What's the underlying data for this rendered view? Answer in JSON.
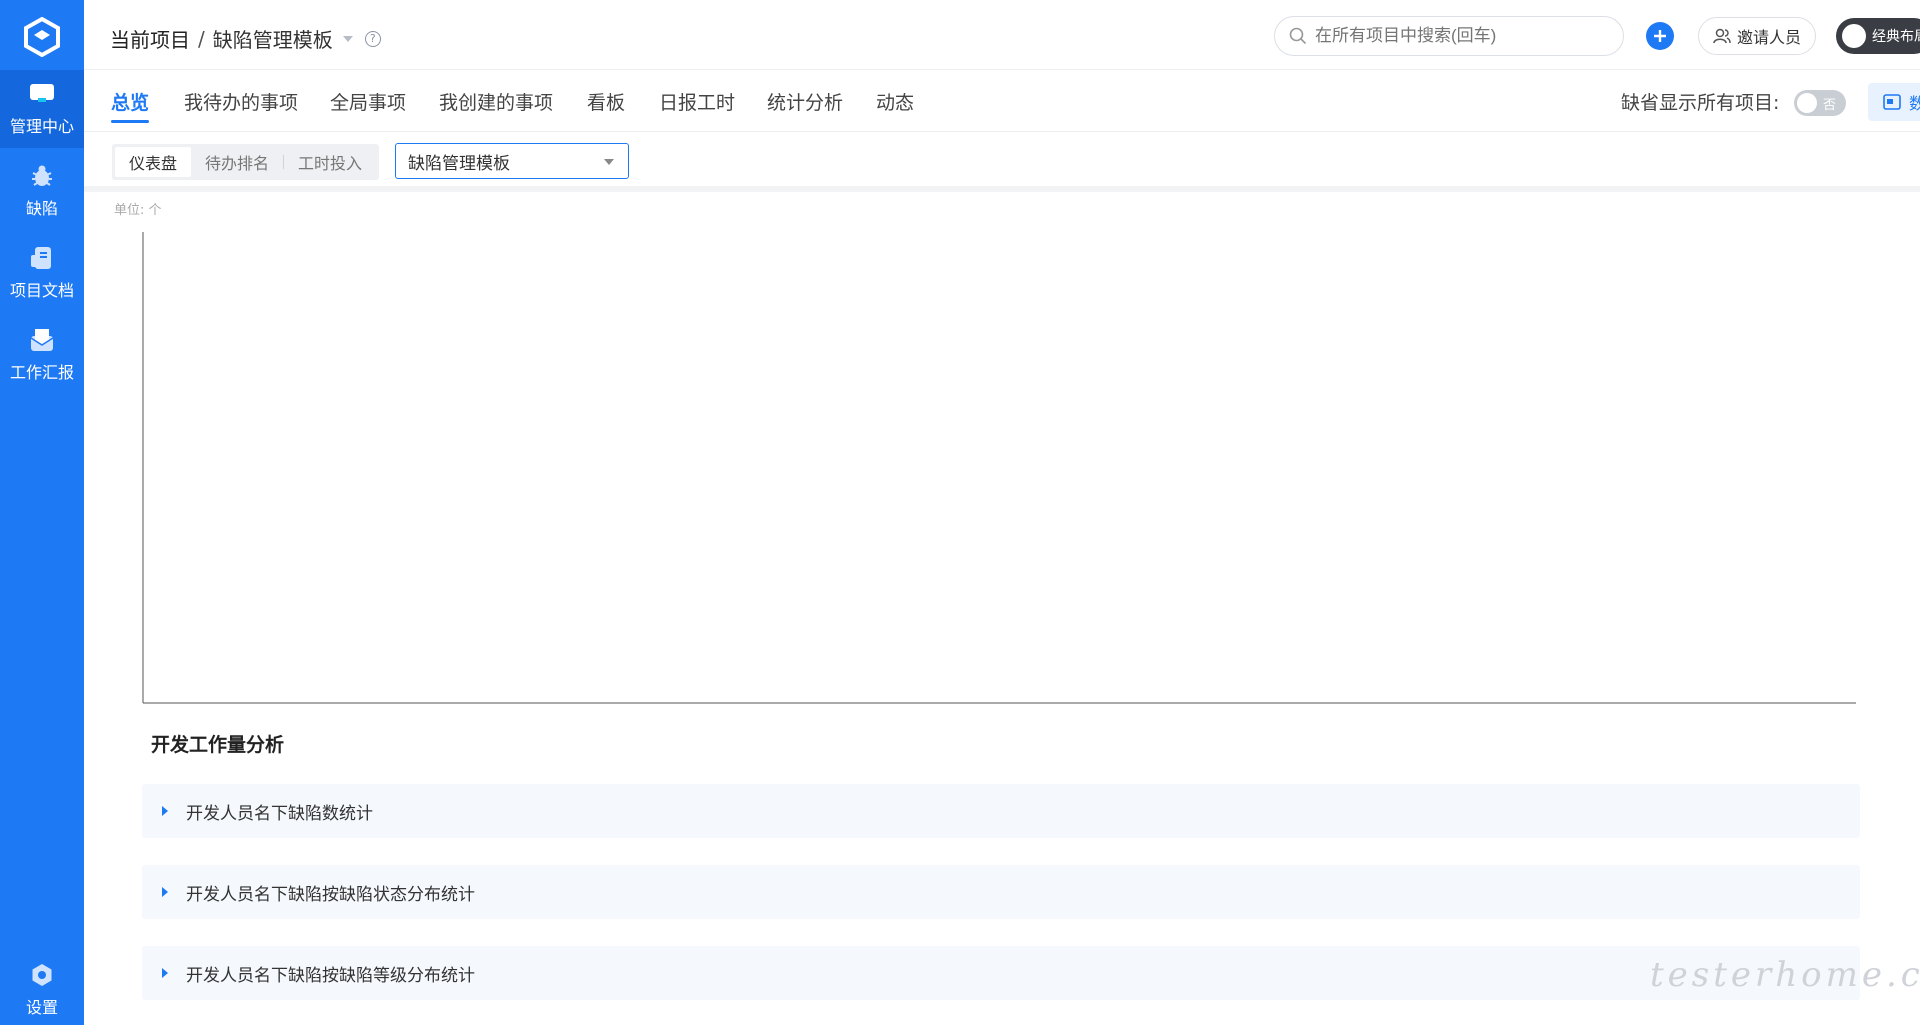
{
  "sidebar": {
    "items": [
      {
        "label": "管理中心",
        "icon": "monitor-icon"
      },
      {
        "label": "缺陷",
        "icon": "bug-icon"
      },
      {
        "label": "项目文档",
        "icon": "document-icon"
      },
      {
        "label": "工作汇报",
        "icon": "mail-icon"
      }
    ],
    "settings_label": "设置"
  },
  "header": {
    "breadcrumb_root": "当前项目",
    "breadcrumb_sep": "/",
    "breadcrumb_current": "缺陷管理模板",
    "help": "?",
    "search_placeholder": "在所有项目中搜索(回车)",
    "invite_label": "邀请人员",
    "layout_label": "经典布局"
  },
  "tabs": {
    "items": [
      "总览",
      "我待办的事项",
      "全局事项",
      "我创建的事项",
      "看板",
      "日报工时",
      "统计分析",
      "动态"
    ],
    "default_all_label": "缺省显示所有项目:",
    "switch_text": "否",
    "big_screen_label": "数字大屏"
  },
  "subbar": {
    "segments": [
      "仪表盘",
      "待办排名",
      "工时投入"
    ],
    "template_select": "缺陷管理模板"
  },
  "chart": {
    "unit_label": "单位: 个"
  },
  "section": {
    "title": "开发工作量分析",
    "panels": [
      "开发人员名下缺陷数统计",
      "开发人员名下缺陷按缺陷状态分布统计",
      "开发人员名下缺陷按缺陷等级分布统计"
    ]
  },
  "watermark": "testerhome.com",
  "colors": {
    "accent": "#1e79f5",
    "sidebar": "#1e79f5"
  }
}
